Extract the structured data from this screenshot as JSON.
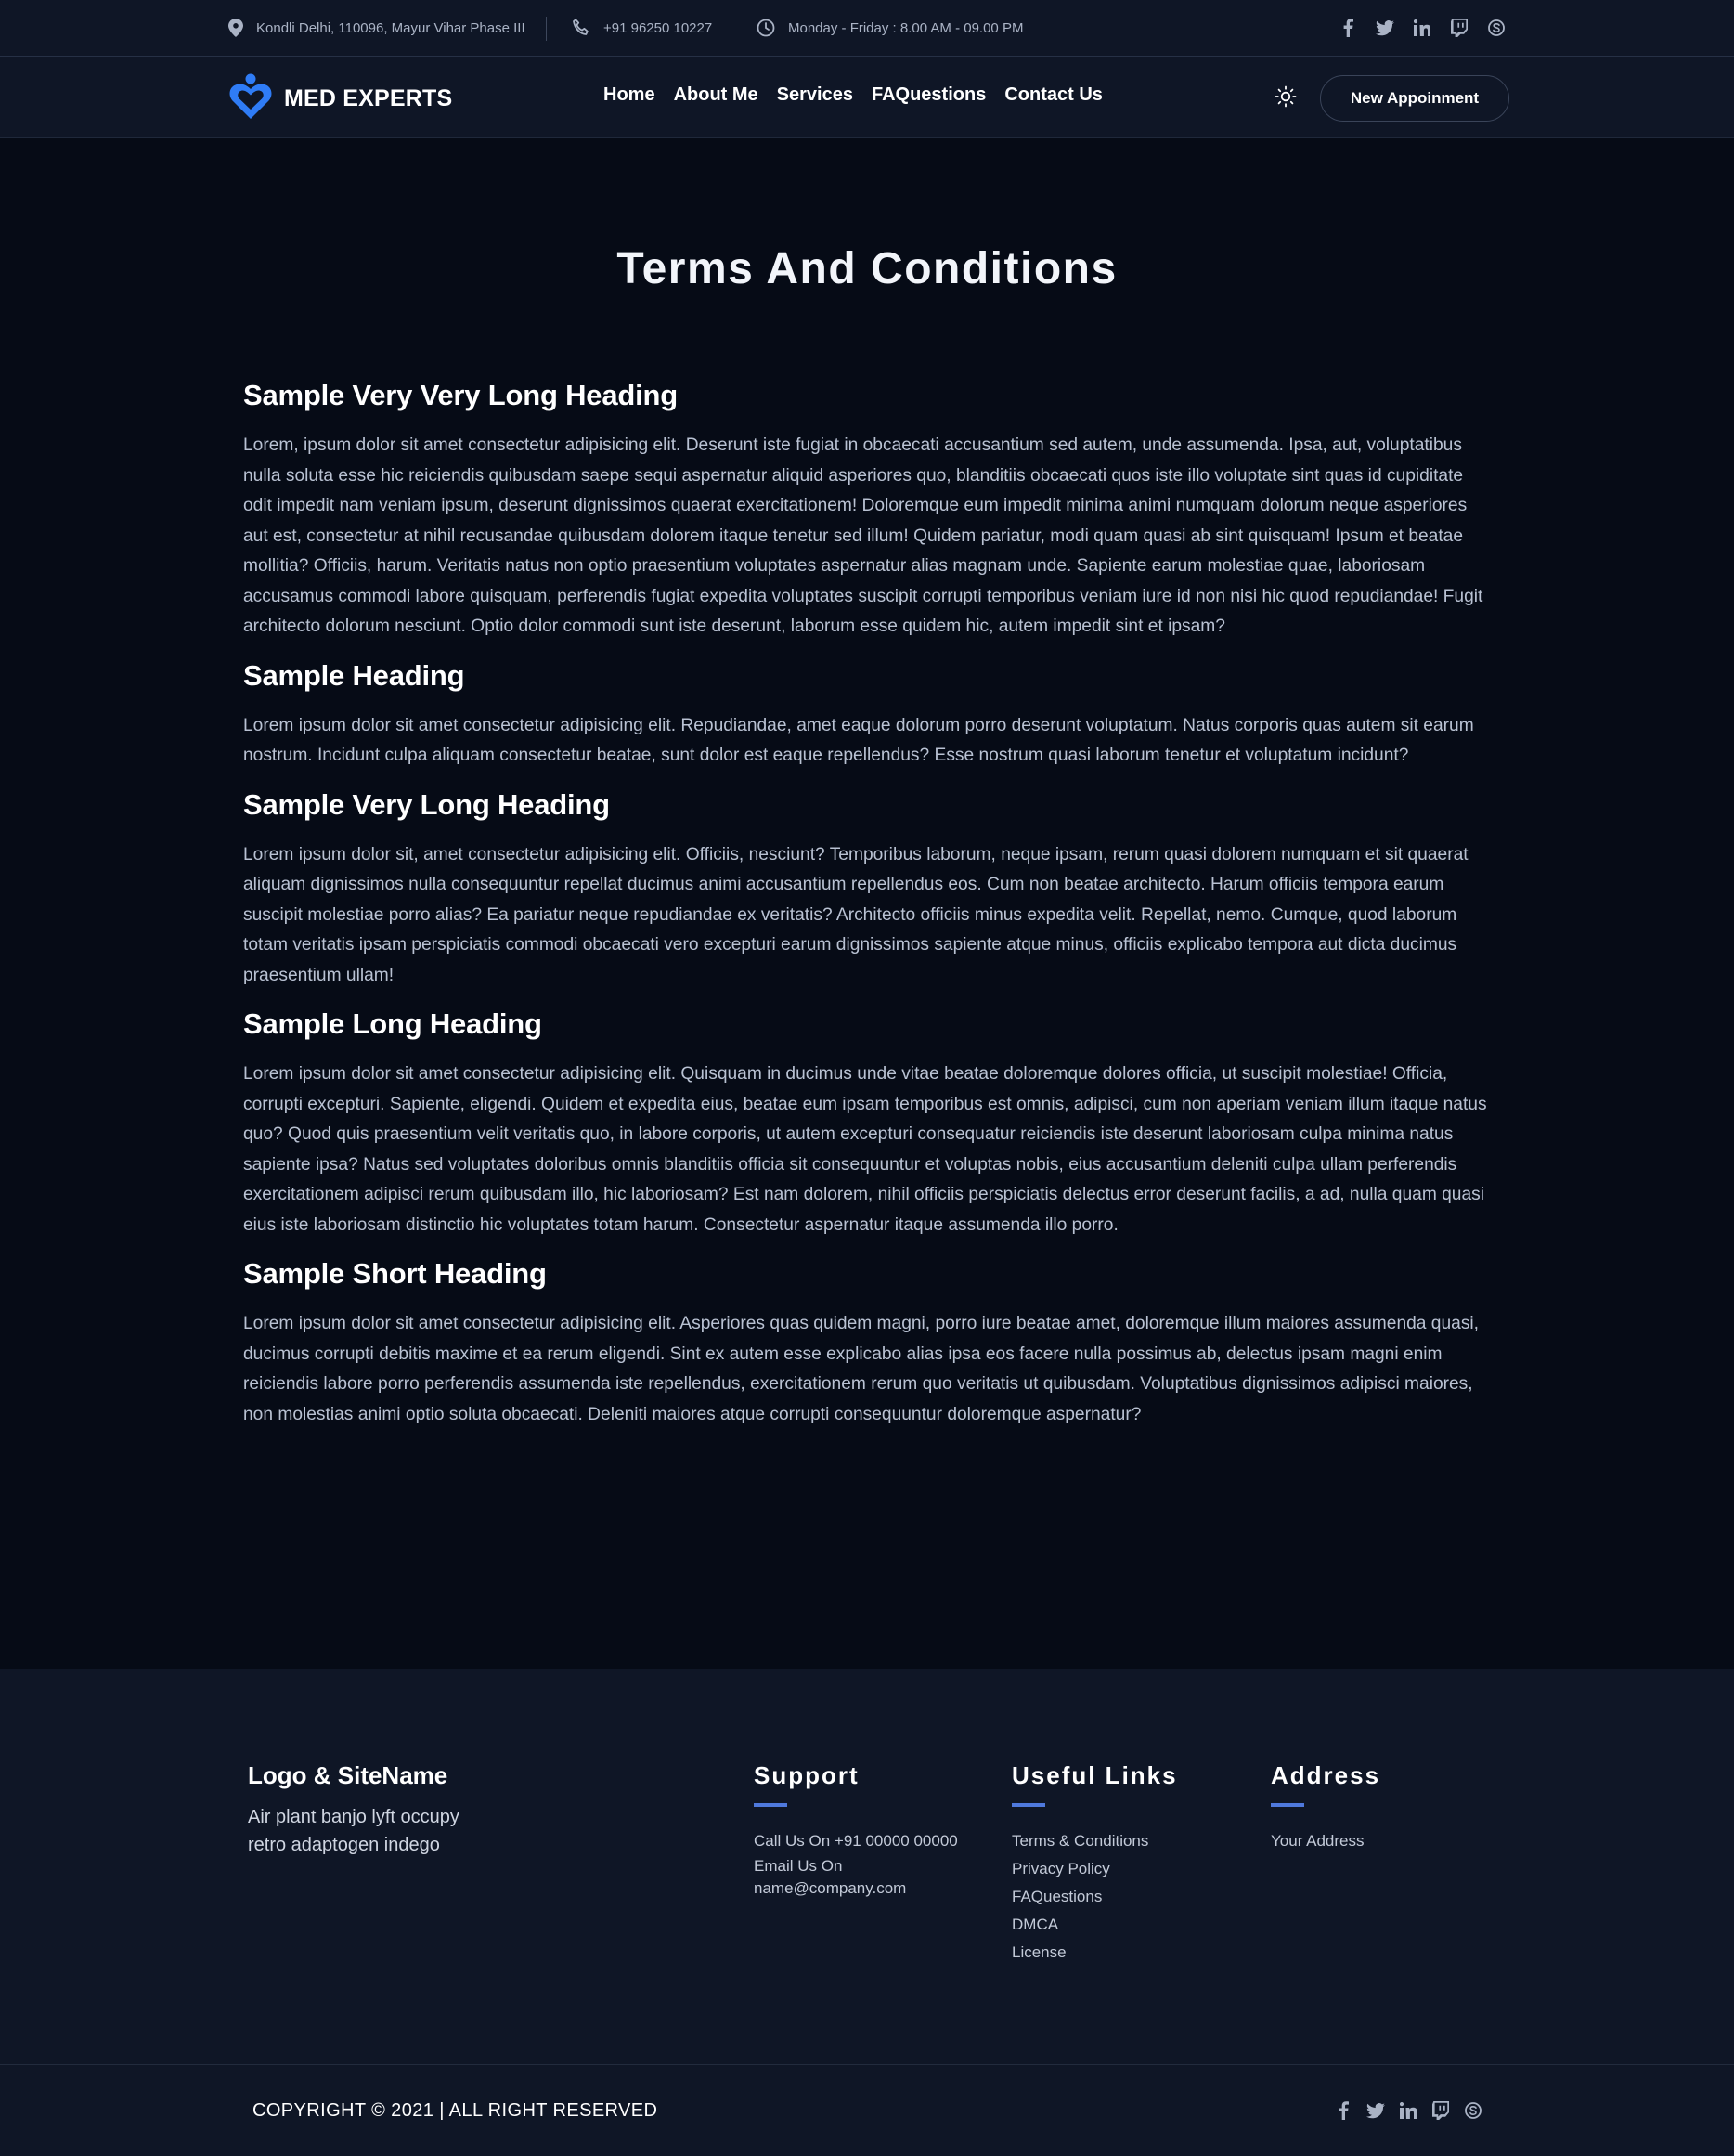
{
  "topbar": {
    "address": "Kondli Delhi, 110096, Mayur Vihar Phase III",
    "phone": "+91 96250 10227",
    "hours": "Monday - Friday : 8.00 AM - 09.00 PM",
    "social": [
      "facebook-icon",
      "twitter-icon",
      "linkedin-icon",
      "twitch-icon",
      "skype-icon"
    ]
  },
  "nav": {
    "brand": "MED EXPERTS",
    "items": [
      {
        "label": "Home"
      },
      {
        "label": "About Me"
      },
      {
        "label": "Services"
      },
      {
        "label": "FAQuestions"
      },
      {
        "label": "Contact Us"
      }
    ],
    "appointment_button": "New Appoinment"
  },
  "page": {
    "title": "Terms And Conditions",
    "sections": [
      {
        "heading": "Sample Very Very Long Heading",
        "body": "Lorem, ipsum dolor sit amet consectetur adipisicing elit. Deserunt iste fugiat in obcaecati accusantium sed autem, unde assumenda. Ipsa, aut, voluptatibus nulla soluta esse hic reiciendis quibusdam saepe sequi aspernatur aliquid asperiores quo, blanditiis obcaecati quos iste illo voluptate sint quas id cupiditate odit impedit nam veniam ipsum, deserunt dignissimos quaerat exercitationem! Doloremque eum impedit minima animi numquam dolorum neque asperiores aut est, consectetur at nihil recusandae quibusdam dolorem itaque tenetur sed illum! Quidem pariatur, modi quam quasi ab sint quisquam! Ipsum et beatae mollitia? Officiis, harum. Veritatis natus non optio praesentium voluptates aspernatur alias magnam unde. Sapiente earum molestiae quae, laboriosam accusamus commodi labore quisquam, perferendis fugiat expedita voluptates suscipit corrupti temporibus veniam iure id non nisi hic quod repudiandae! Fugit architecto dolorum nesciunt. Optio dolor commodi sunt iste deserunt, laborum esse quidem hic, autem impedit sint et ipsam?"
      },
      {
        "heading": "Sample Heading",
        "body": "Lorem ipsum dolor sit amet consectetur adipisicing elit. Repudiandae, amet eaque dolorum porro deserunt voluptatum. Natus corporis quas autem sit earum nostrum. Incidunt culpa aliquam consectetur beatae, sunt dolor est eaque repellendus? Esse nostrum quasi laborum tenetur et voluptatum incidunt?"
      },
      {
        "heading": "Sample Very Long Heading",
        "body": "Lorem ipsum dolor sit, amet consectetur adipisicing elit. Officiis, nesciunt? Temporibus laborum, neque ipsam, rerum quasi dolorem numquam et sit quaerat aliquam dignissimos nulla consequuntur repellat ducimus animi accusantium repellendus eos. Cum non beatae architecto. Harum officiis tempora earum suscipit molestiae porro alias? Ea pariatur neque repudiandae ex veritatis? Architecto officiis minus expedita velit. Repellat, nemo. Cumque, quod laborum totam veritatis ipsam perspiciatis commodi obcaecati vero excepturi earum dignissimos sapiente atque minus, officiis explicabo tempora aut dicta ducimus praesentium ullam!"
      },
      {
        "heading": "Sample Long Heading",
        "body": "Lorem ipsum dolor sit amet consectetur adipisicing elit. Quisquam in ducimus unde vitae beatae doloremque dolores officia, ut suscipit molestiae! Officia, corrupti excepturi. Sapiente, eligendi. Quidem et expedita eius, beatae eum ipsam temporibus est omnis, adipisci, cum non aperiam veniam illum itaque natus quo? Quod quis praesentium velit veritatis quo, in labore corporis, ut autem excepturi consequatur reiciendis iste deserunt laboriosam culpa minima natus sapiente ipsa? Natus sed voluptates doloribus omnis blanditiis officia sit consequuntur et voluptas nobis, eius accusantium deleniti culpa ullam perferendis exercitationem adipisci rerum quibusdam illo, hic laboriosam? Est nam dolorem, nihil officiis perspiciatis delectus error deserunt facilis, a ad, nulla quam quasi eius iste laboriosam distinctio hic voluptates totam harum. Consectetur aspernatur itaque assumenda illo porro."
      },
      {
        "heading": "Sample Short Heading",
        "body": "Lorem ipsum dolor sit amet consectetur adipisicing elit. Asperiores quas quidem magni, porro iure beatae amet, doloremque illum maiores assumenda quasi, ducimus corrupti debitis maxime et ea rerum eligendi. Sint ex autem esse explicabo alias ipsa eos facere nulla possimus ab, delectus ipsam magni enim reiciendis labore porro perferendis assumenda iste repellendus, exercitationem rerum quo veritatis ut quibusdam. Voluptatibus dignissimos adipisci maiores, non molestias animi optio soluta obcaecati. Deleniti maiores atque corrupti consequuntur doloremque aspernatur?"
      }
    ]
  },
  "footer": {
    "logo_title": "Logo & SiteName",
    "logo_desc": "Air plant banjo lyft occupy retro adaptogen indego",
    "support": {
      "title": "Support",
      "call": "Call Us On +91 00000 00000",
      "email_label": "Email Us On",
      "email": "name@company.com"
    },
    "links": {
      "title": "Useful Links",
      "items": [
        {
          "label": "Terms & Conditions"
        },
        {
          "label": "Privacy Policy"
        },
        {
          "label": "FAQuestions"
        },
        {
          "label": "DMCA"
        },
        {
          "label": "License"
        }
      ]
    },
    "address": {
      "title": "Address",
      "value": "Your Address"
    },
    "copyright": "COPYRIGHT © 2021 | ALL RIGHT RESERVED"
  },
  "colors": {
    "background": "#060b16",
    "panel": "#0f1626",
    "accent": "#4f79dd",
    "logo": "#2f7cf6"
  }
}
